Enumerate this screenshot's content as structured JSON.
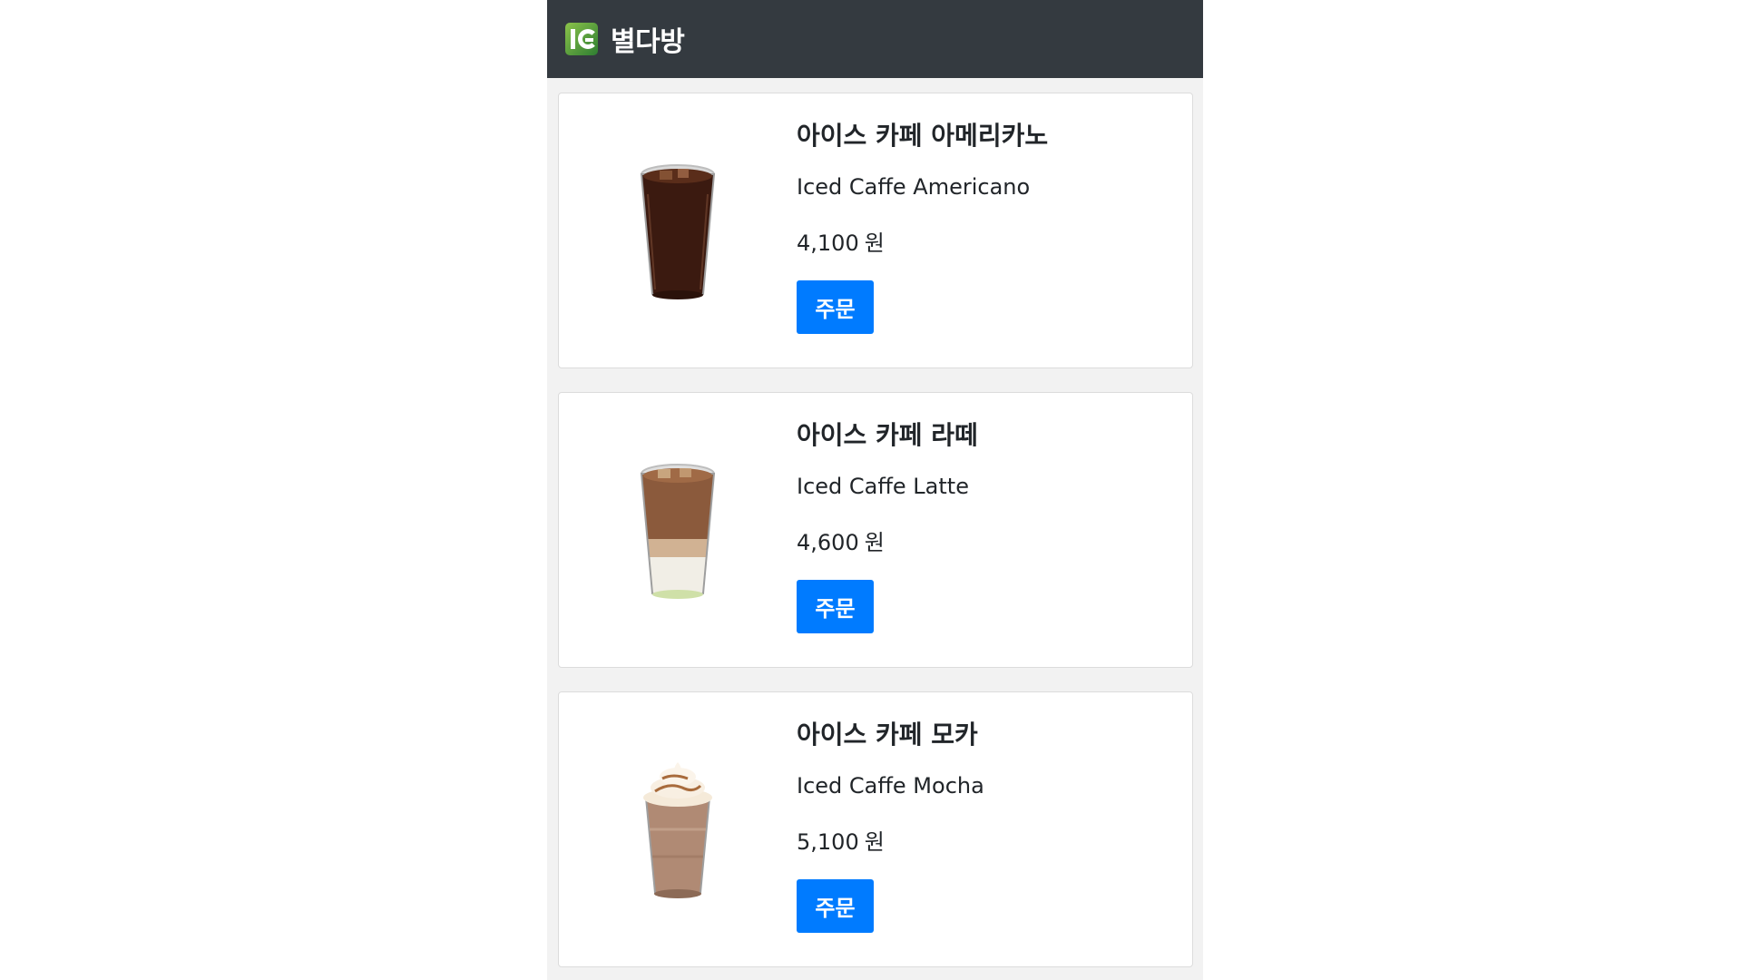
{
  "navbar": {
    "logo_icon": "ig-logo-icon",
    "brand": "별다방"
  },
  "menu": {
    "items": [
      {
        "name_ko": "아이스 카페 아메리카노",
        "name_en": "Iced Caffe Americano",
        "price": "4,100",
        "currency": "원",
        "order_label": "주문",
        "image": "iced-americano-image"
      },
      {
        "name_ko": "아이스 카페 라떼",
        "name_en": "Iced Caffe Latte",
        "price": "4,600",
        "currency": "원",
        "order_label": "주문",
        "image": "iced-latte-image"
      },
      {
        "name_ko": "아이스 카페 모카",
        "name_en": "Iced Caffe Mocha",
        "price": "5,100",
        "currency": "원",
        "order_label": "주문",
        "image": "iced-mocha-image"
      }
    ]
  },
  "colors": {
    "navbar_bg": "#343a40",
    "page_bg": "#f2f2f2",
    "button_bg": "#007bff"
  }
}
